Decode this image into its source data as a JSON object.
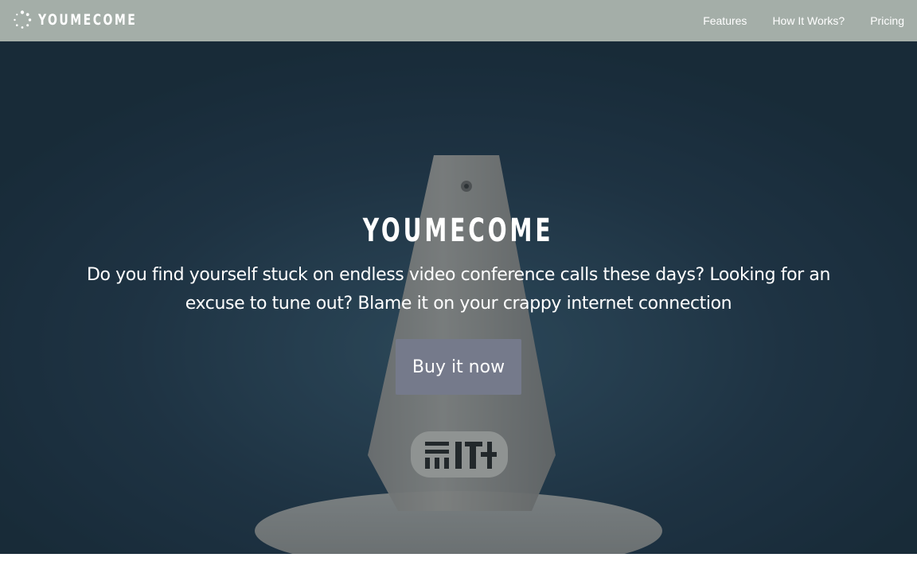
{
  "navbar": {
    "brand": "YOUMECOME",
    "links": [
      "Features",
      "How It Works?",
      "Pricing"
    ]
  },
  "hero": {
    "title": "YOUMECOME",
    "subtitle": "Do you find yourself stuck on endless video conference calls these days? Looking for an excuse to tune out? Blame it on your crappy internet connection",
    "cta_label": "Buy it now"
  },
  "colors": {
    "navbar_bg": "#a4aea8",
    "hero_bg": "#223848",
    "button_bg": "#757a8b",
    "text": "#ffffff"
  },
  "icons": {
    "logo": "dotted-circle-icon"
  }
}
